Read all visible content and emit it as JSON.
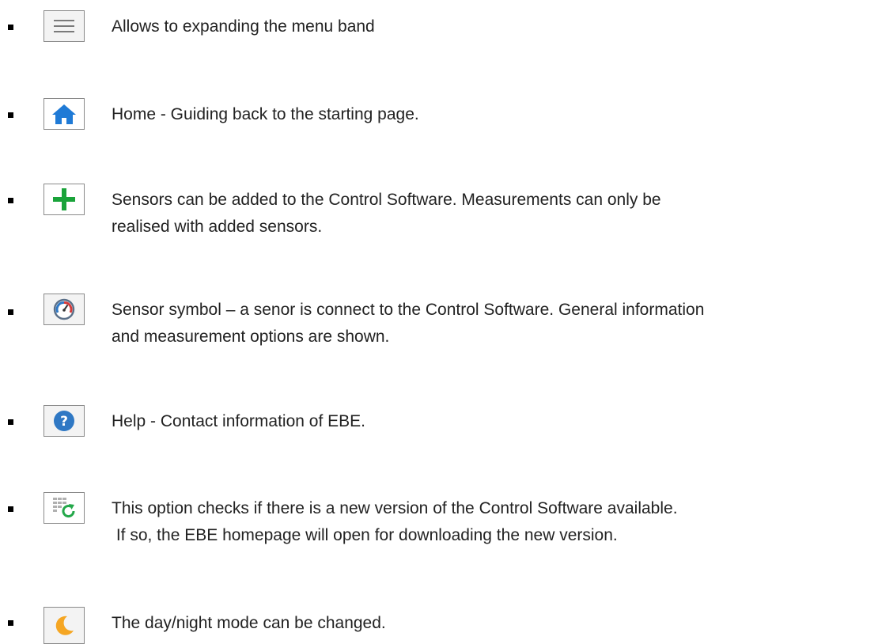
{
  "items": [
    {
      "icon": "menu-icon",
      "text": "Allows to expanding the menu band"
    },
    {
      "icon": "home-icon",
      "text": "Home - Guiding back to the starting page."
    },
    {
      "icon": "plus-icon",
      "line1": "Sensors can be added to the Control Software. Measurements can only be",
      "line2": "realised with added sensors."
    },
    {
      "icon": "gauge-icon",
      "line1": "Sensor symbol – a senor is connect to the Control Software. General information",
      "line2": "and measurement options are shown."
    },
    {
      "icon": "help-icon",
      "text": "Help - Contact information of EBE."
    },
    {
      "icon": "update-check-icon",
      "line1": "This option checks if there is a new version of the Control Software available.",
      "line2": " If so, the EBE homepage will open for downloading the new version."
    },
    {
      "icon": "moon-icon",
      "text": "The day/night mode can be changed."
    }
  ],
  "colors": {
    "home_blue": "#1f7ad6",
    "plus_green": "#1aa33a",
    "help_blue": "#2f78c4",
    "refresh_green": "#24a84a",
    "moon_orange": "#f5a623"
  }
}
